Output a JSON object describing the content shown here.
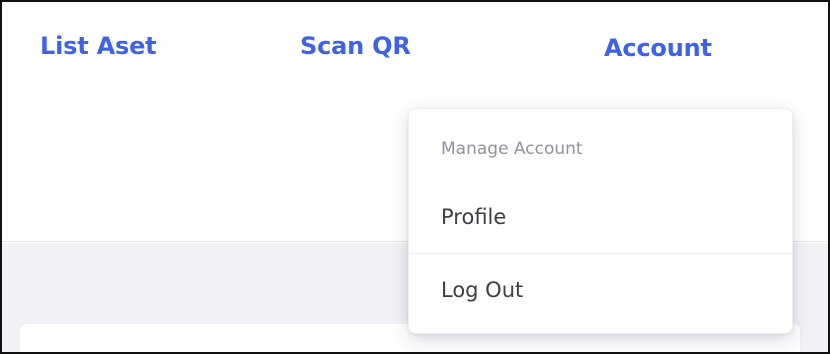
{
  "nav": {
    "list_aset": "List Aset",
    "scan_qr": "Scan QR",
    "account": "Account"
  },
  "account_menu": {
    "header": "Manage Account",
    "profile": "Profile",
    "logout": "Log Out"
  },
  "colors": {
    "nav_link": "#3f63e6",
    "page_background": "#f1f2f5",
    "menu_text": "#3b3f46",
    "menu_header_text": "#8e939c"
  }
}
